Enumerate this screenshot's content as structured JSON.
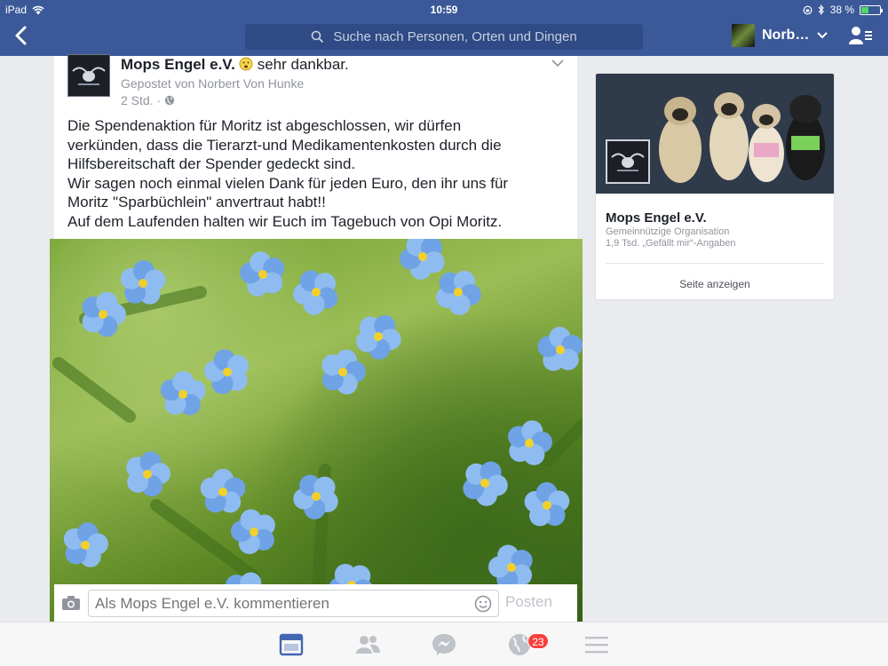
{
  "status_bar": {
    "device": "iPad",
    "time": "10:59",
    "battery": "38 %",
    "battery_level": 0.38
  },
  "nav": {
    "search_placeholder": "Suche nach Personen, Orten und Dingen",
    "user_name": "Norb…"
  },
  "post": {
    "page_name": "Mops Engel e.V.",
    "feeling": "sehr dankbar.",
    "posted_by": "Gepostet von Norbert Von Hunke",
    "time": "2 Std. ·",
    "text_lines": [
      "Die Spendenaktion für Moritz ist abgeschlossen, wir dürfen",
      "verkünden, dass die Tierarzt-und Medikamentenkosten durch die",
      "Hilfsbereitschaft der Spender gedeckt sind.",
      "Wir sagen noch einmal vielen Dank für jeden Euro, den ihr uns für",
      "Moritz \"Sparbüchlein\" anvertraut habt!!",
      "Auf dem Laufenden halten wir Euch im Tagebuch von Opi Moritz."
    ]
  },
  "comment": {
    "placeholder": "Als Mops Engel e.V. kommentieren",
    "post_label": "Posten"
  },
  "page_card": {
    "name": "Mops Engel e.V.",
    "category": "Gemeinnützige Organisation",
    "likes": "1,9 Tsd. „Gefällt mir“-Angaben",
    "link": "Seite anzeigen"
  },
  "tabbar": {
    "notifications_count": "23"
  },
  "colors": {
    "brand": "#3b5998",
    "badge": "#fa3e3e",
    "active_tab": "#4267b2"
  }
}
